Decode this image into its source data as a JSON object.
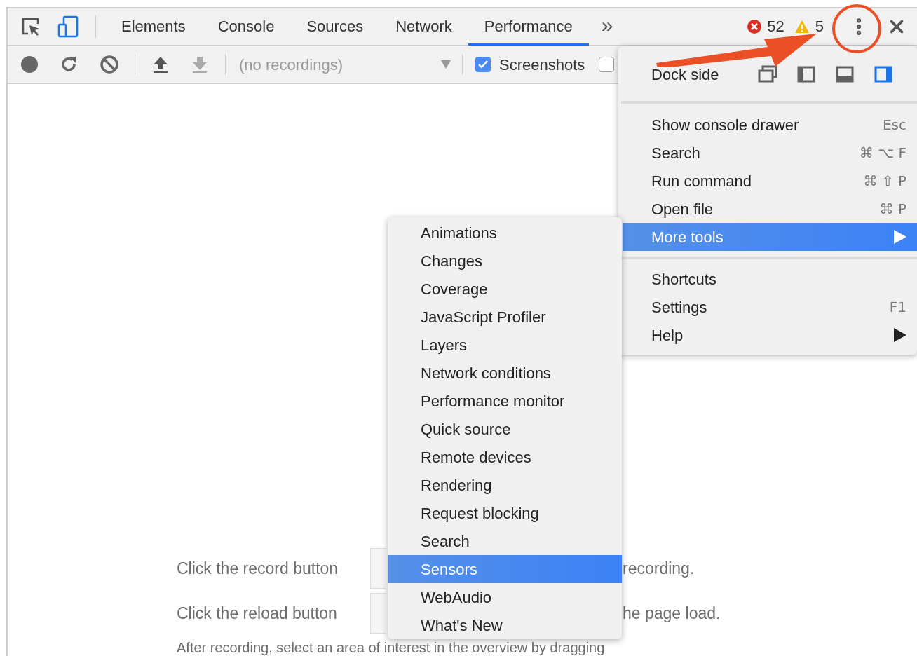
{
  "tabs": [
    {
      "label": "Elements",
      "selected": false
    },
    {
      "label": "Console",
      "selected": false
    },
    {
      "label": "Sources",
      "selected": false
    },
    {
      "label": "Network",
      "selected": false
    },
    {
      "label": "Performance",
      "selected": true
    }
  ],
  "more_tabs": "»",
  "issues": {
    "errors": "52",
    "warnings": "5"
  },
  "toolbar": {
    "recordings_placeholder": "(no recordings)",
    "screenshots": {
      "label": "Screenshots",
      "checked": true
    },
    "checkbox_2": {
      "checked": false
    }
  },
  "content": {
    "lines": [
      {
        "left": "Click the record button",
        "right": "recording."
      },
      {
        "left": "Click the reload button",
        "right": "he page load."
      }
    ],
    "footer": "After recording, select an area of interest in the overview by dragging"
  },
  "main_menu": {
    "dock_side": {
      "label": "Dock side",
      "options": [
        {
          "kind": "undock",
          "selected": false
        },
        {
          "kind": "left",
          "selected": false
        },
        {
          "kind": "bottom",
          "selected": false
        },
        {
          "kind": "right",
          "selected": true
        }
      ]
    },
    "groups": [
      [
        {
          "label": "Show console drawer",
          "shortcut": "Esc",
          "submenu": false,
          "selected": false
        },
        {
          "label": "Search",
          "shortcut": "⌘ ⌥ F",
          "submenu": false,
          "selected": false
        },
        {
          "label": "Run command",
          "shortcut": "⌘ ⇧ P",
          "submenu": false,
          "selected": false
        },
        {
          "label": "Open file",
          "shortcut": "⌘ P",
          "submenu": false,
          "selected": false
        },
        {
          "label": "More tools",
          "submenu": true,
          "selected": true
        }
      ],
      [
        {
          "label": "Shortcuts",
          "submenu": false,
          "selected": false
        },
        {
          "label": "Settings",
          "shortcut": "F1",
          "submenu": false,
          "selected": false
        },
        {
          "label": "Help",
          "submenu": true,
          "selected": false
        }
      ]
    ]
  },
  "submenu": {
    "items": [
      {
        "label": "Animations",
        "selected": false
      },
      {
        "label": "Changes",
        "selected": false
      },
      {
        "label": "Coverage",
        "selected": false
      },
      {
        "label": "JavaScript Profiler",
        "selected": false
      },
      {
        "label": "Layers",
        "selected": false
      },
      {
        "label": "Network conditions",
        "selected": false
      },
      {
        "label": "Performance monitor",
        "selected": false
      },
      {
        "label": "Quick source",
        "selected": false
      },
      {
        "label": "Remote devices",
        "selected": false
      },
      {
        "label": "Rendering",
        "selected": false
      },
      {
        "label": "Request blocking",
        "selected": false
      },
      {
        "label": "Search",
        "selected": false
      },
      {
        "label": "Sensors",
        "selected": true
      },
      {
        "label": "WebAudio",
        "selected": false
      },
      {
        "label": "What's New",
        "selected": false
      }
    ]
  }
}
